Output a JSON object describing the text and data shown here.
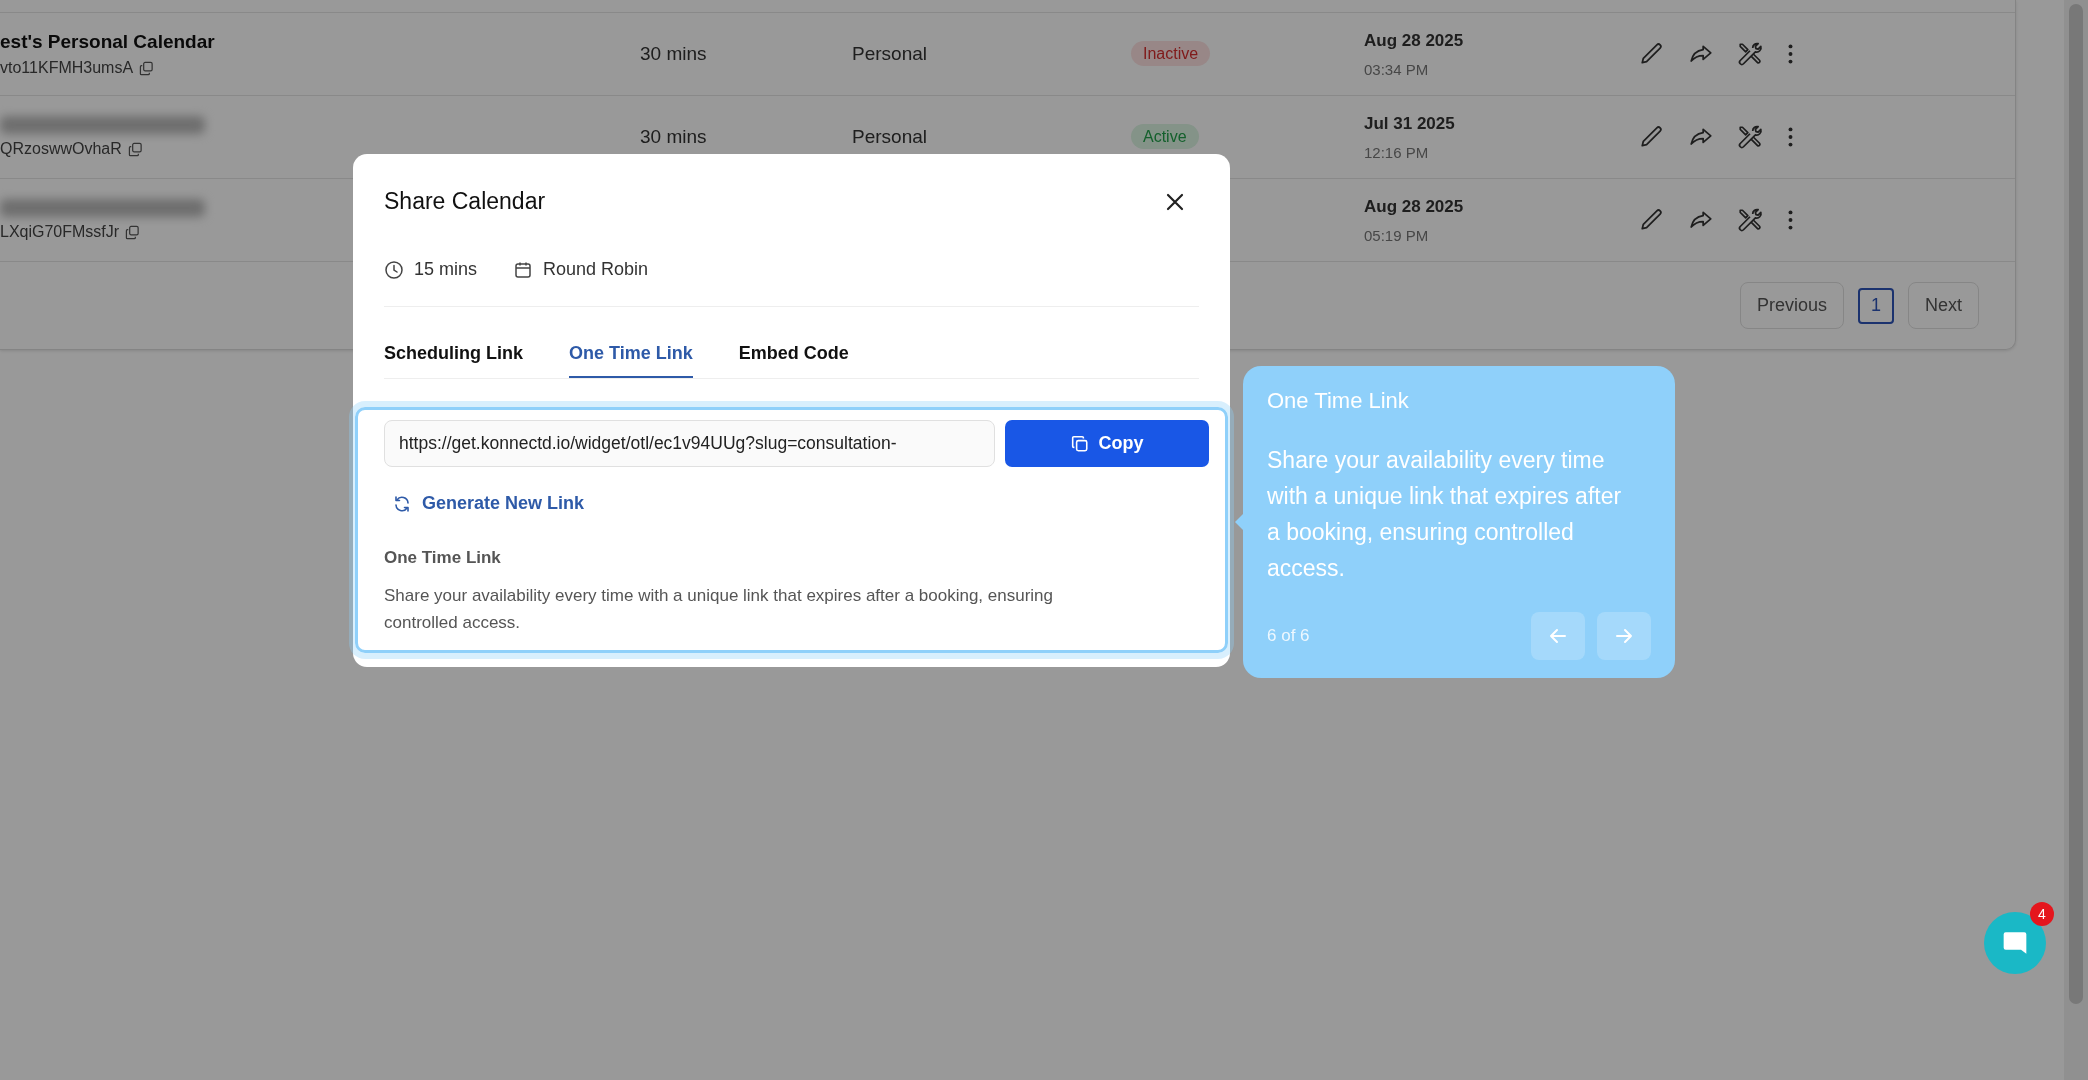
{
  "table": {
    "rows": [
      {
        "name": "est's Personal Calendar",
        "blurred": false,
        "code": "vto11KFMH3umsA",
        "duration": "30 mins",
        "type": "Personal",
        "status": {
          "label": "Inactive",
          "kind": "inactive"
        },
        "date": "Aug 28 2025",
        "time": "03:34 PM"
      },
      {
        "blurred": true,
        "code": "QRzoswwOvhaR",
        "duration": "30 mins",
        "type": "Personal",
        "status": {
          "label": "Active",
          "kind": "active"
        },
        "date": "Jul 31 2025",
        "time": "12:16 PM"
      },
      {
        "blurred": true,
        "code": "LXqiG70FMssfJr",
        "date": "Aug 28 2025",
        "time": "05:19 PM"
      }
    ]
  },
  "pagination": {
    "previous": "Previous",
    "pages": [
      {
        "label": "1",
        "selected": true
      }
    ],
    "next": "Next"
  },
  "modal": {
    "title": "Share Calendar",
    "meta": [
      {
        "kind": "duration",
        "text": "15 mins"
      },
      {
        "kind": "event_type",
        "text": "Round Robin"
      }
    ],
    "tabs": [
      {
        "label": "Scheduling Link",
        "selected": false
      },
      {
        "label": "One Time Link",
        "selected": true
      },
      {
        "label": "Embed Code",
        "selected": false
      }
    ],
    "link": "https://get.konnectd.io/widget/otl/ec1v94UUg?slug=consultation-",
    "copy": "Copy",
    "generate": "Generate New Link",
    "info_title": "One Time Link",
    "info_text": "Share your availability every time with a unique link that expires after a booking, ensuring controlled access."
  },
  "tour": {
    "title": "One Time Link",
    "text": "Share your availability every time with a unique link that expires after a booking, ensuring controlled access.",
    "counter": "6 of 6"
  },
  "chat": {
    "badge": "4"
  }
}
